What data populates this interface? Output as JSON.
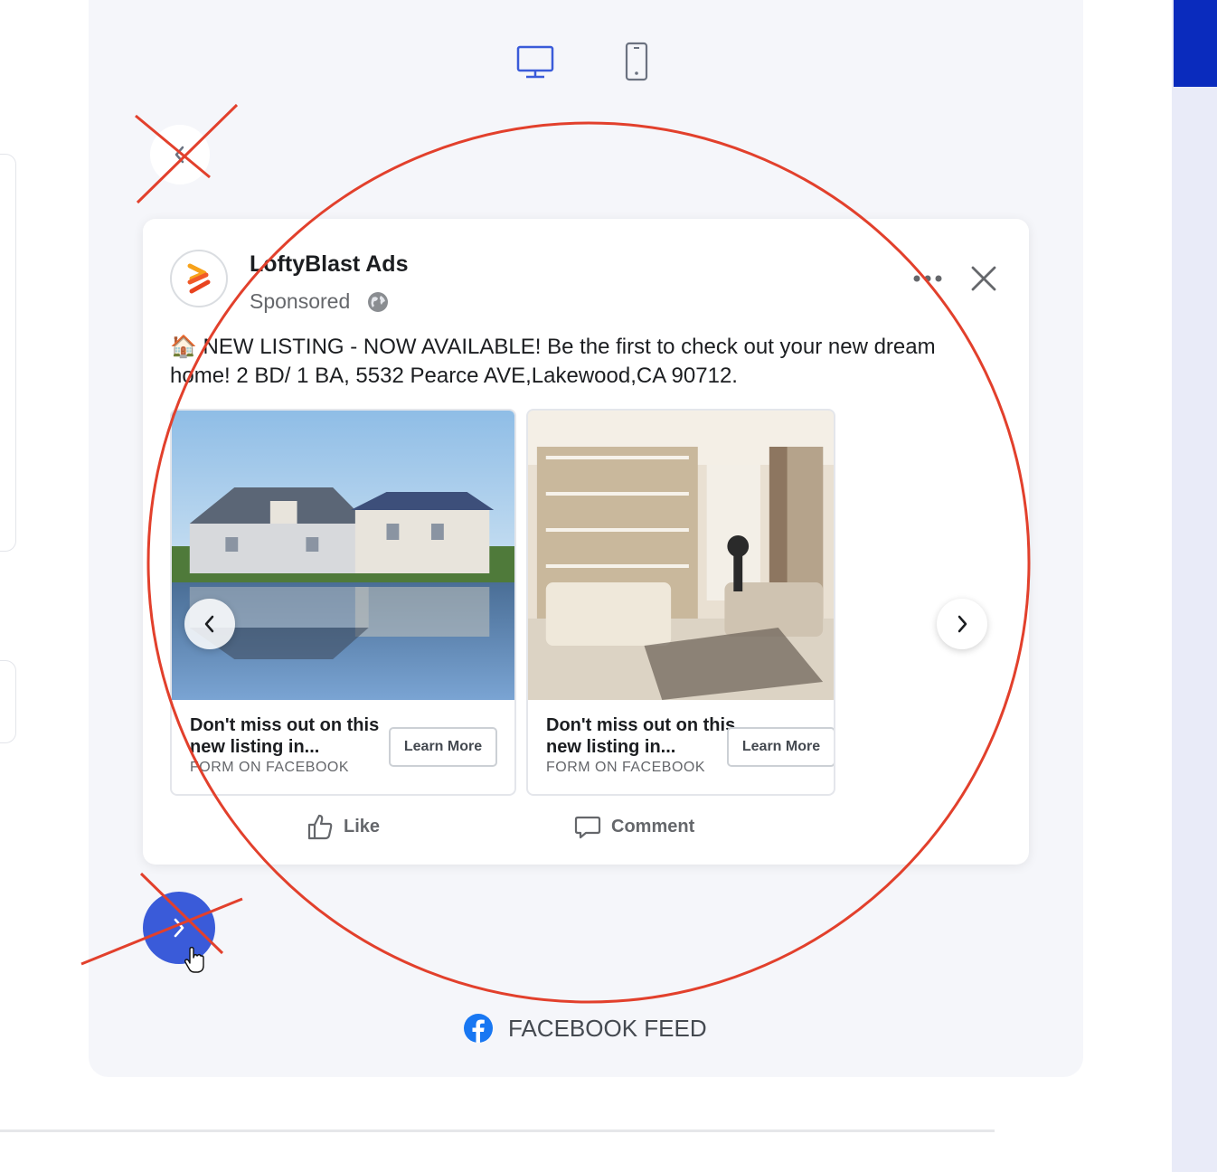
{
  "device_toggle": {
    "desktop_icon": "desktop-monitor-icon",
    "mobile_icon": "mobile-phone-icon",
    "active": "desktop",
    "active_color": "#3a5bd9"
  },
  "ad": {
    "page_name": "LoftyBlast Ads",
    "sponsored_label": "Sponsored",
    "primary_text": "🏠 NEW LISTING - NOW AVAILABLE! Be the first to check out your new dream home! 2 BD/ 1 BA, 5532 Pearce AVE,Lakewood,CA 90712.",
    "cards": [
      {
        "image": "house-waterfront-photo",
        "headline": "Don't miss out on this new listing in...",
        "link_caption": "FORM ON FACEBOOK",
        "cta_label": "Learn More"
      },
      {
        "image": "living-room-interior-photo",
        "headline": "Don't miss out on this new listing in...",
        "link_caption": "FORM ON FACEBOOK",
        "cta_label": "Learn More"
      }
    ],
    "actions": {
      "like_label": "Like",
      "comment_label": "Comment"
    }
  },
  "placement": {
    "label": "FACEBOOK FEED",
    "icon": "facebook-logo-icon",
    "brand_color": "#1877f2"
  },
  "colors": {
    "accent": "#3a5bd9",
    "annotation": "#e2402c",
    "sidebar_highlight": "#0a2bbd"
  }
}
